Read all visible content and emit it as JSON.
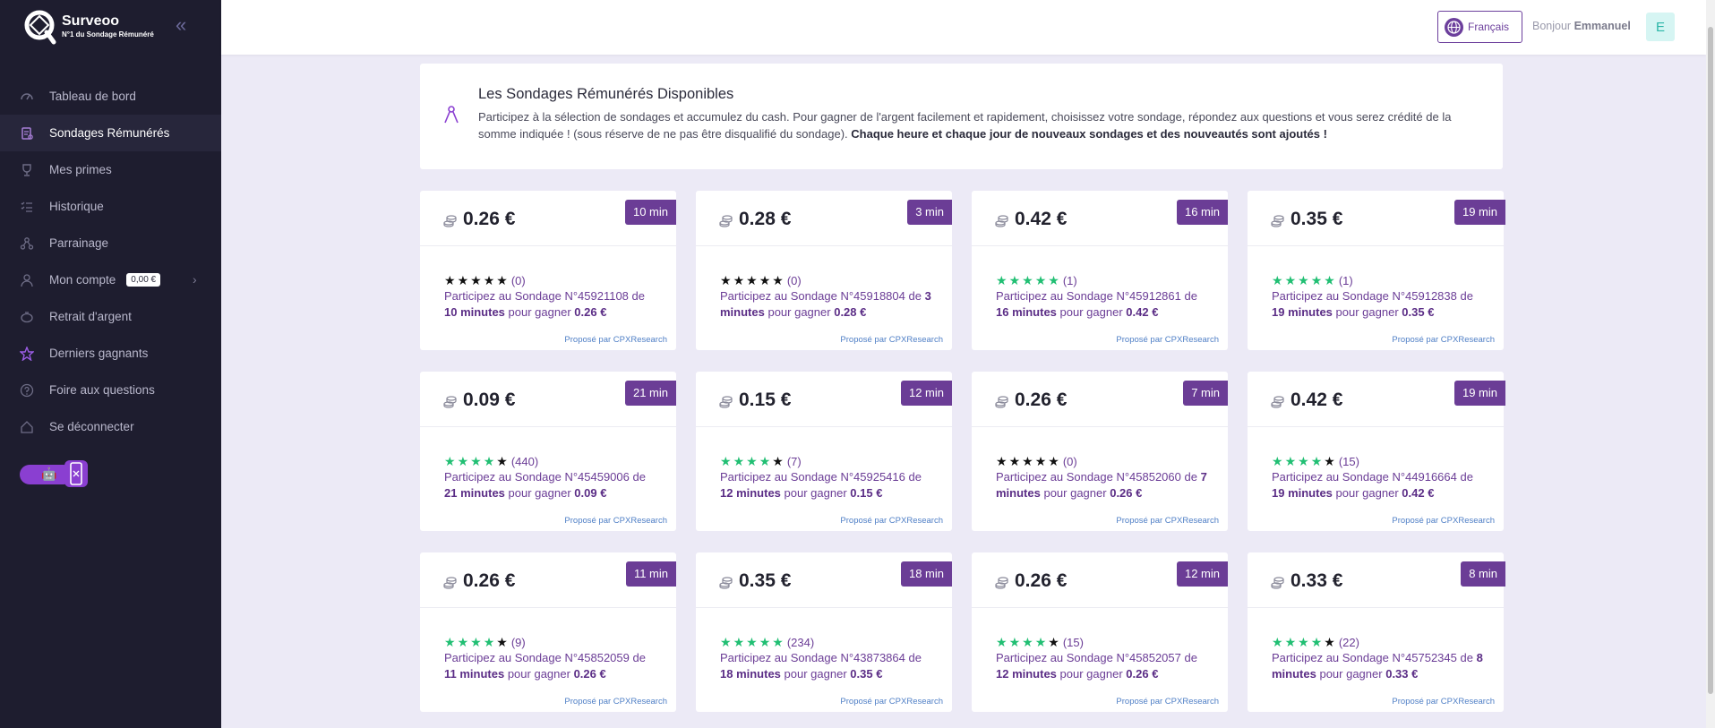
{
  "brand": {
    "name": "Surveoo",
    "tagline": "N°1 du Sondage Rémunéré"
  },
  "nav": [
    {
      "label": "Tableau de bord",
      "icon": "dashboard-icon"
    },
    {
      "label": "Sondages Rémunérés",
      "icon": "survey-icon",
      "active": true
    },
    {
      "label": "Mes primes",
      "icon": "trophy-icon"
    },
    {
      "label": "Historique",
      "icon": "history-list-icon"
    },
    {
      "label": "Parrainage",
      "icon": "referral-icon"
    },
    {
      "label": "Mon compte",
      "icon": "user-icon",
      "badge": "0,00 €"
    },
    {
      "label": "Retrait d'argent",
      "icon": "piggy-bank-icon"
    },
    {
      "label": "Derniers gagnants",
      "icon": "star-icon"
    },
    {
      "label": "Foire aux questions",
      "icon": "help-icon"
    },
    {
      "label": "Se déconnecter",
      "icon": "logout-icon"
    }
  ],
  "topbar": {
    "language": "Français",
    "greeting": "Bonjour",
    "username": "Emmanuel",
    "avatar_letter": "E"
  },
  "intro": {
    "title": "Les Sondages Rémunérés Disponibles",
    "text": "Participez à la sélection de sondages et accumulez du cash. Pour gagner de l'argent facilement et rapidement, choisissez votre sondage, répondez aux questions et vous serez crédité de la somme indiquée ! (sous réserve de ne pas être disqualifié du sondage).",
    "text_bold": "Chaque heure et chaque jour de nouveaux sondages et des nouveautés sont ajoutés !"
  },
  "card_text": {
    "prefix": "Participez au Sondage ",
    "of": "de",
    "gain": "pour gagner",
    "provider": "Proposé par CPXResearch"
  },
  "surveys": [
    {
      "price": "0.26 €",
      "duration": "10 min",
      "green_stars": 0,
      "count": "(0)",
      "id": "N°45921108",
      "minutes": "10 minutes"
    },
    {
      "price": "0.28 €",
      "duration": "3 min",
      "green_stars": 0,
      "count": "(0)",
      "id": "N°45918804",
      "minutes": "3 minutes"
    },
    {
      "price": "0.42 €",
      "duration": "16 min",
      "green_stars": 5,
      "count": "(1)",
      "id": "N°45912861",
      "minutes": "16 minutes"
    },
    {
      "price": "0.35 €",
      "duration": "19 min",
      "green_stars": 5,
      "count": "(1)",
      "id": "N°45912838",
      "minutes": "19 minutes"
    },
    {
      "price": "0.09 €",
      "duration": "21 min",
      "green_stars": 4,
      "count": "(440)",
      "id": "N°45459006",
      "minutes": "21 minutes"
    },
    {
      "price": "0.15 €",
      "duration": "12 min",
      "green_stars": 4,
      "count": "(7)",
      "id": "N°45925416",
      "minutes": "12 minutes"
    },
    {
      "price": "0.26 €",
      "duration": "7 min",
      "green_stars": 0,
      "count": "(0)",
      "id": "N°45852060",
      "minutes": "7 minutes"
    },
    {
      "price": "0.42 €",
      "duration": "19 min",
      "green_stars": 4,
      "count": "(15)",
      "id": "N°44916664",
      "minutes": "19 minutes"
    },
    {
      "price": "0.26 €",
      "duration": "11 min",
      "green_stars": 4,
      "count": "(9)",
      "id": "N°45852059",
      "minutes": "11 minutes"
    },
    {
      "price": "0.35 €",
      "duration": "18 min",
      "green_stars": 5,
      "count": "(234)",
      "id": "N°43873864",
      "minutes": "18 minutes"
    },
    {
      "price": "0.26 €",
      "duration": "12 min",
      "green_stars": 4,
      "count": "(15)",
      "id": "N°45852057",
      "minutes": "12 minutes"
    },
    {
      "price": "0.33 €",
      "duration": "8 min",
      "green_stars": 4,
      "count": "(22)",
      "id": "N°45752345",
      "minutes": "8 minutes"
    }
  ],
  "colors": {
    "sidebar": "#1e1d2f",
    "accent": "#6b3d96",
    "star_green": "#21bf73",
    "provider_link": "#4f7fc6"
  }
}
